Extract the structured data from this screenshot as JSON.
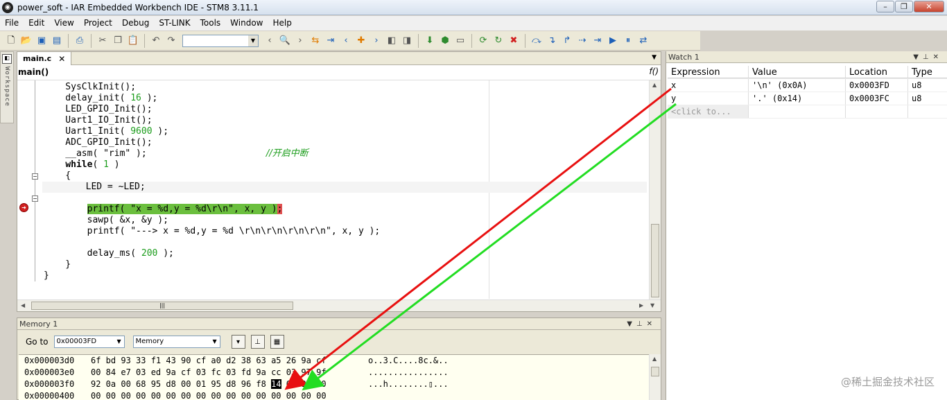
{
  "window": {
    "title": "power_soft - IAR Embedded Workbench IDE - STM8 3.11.1",
    "controls": [
      "–",
      "❐",
      "✕"
    ]
  },
  "menu": [
    "File",
    "Edit",
    "View",
    "Project",
    "Debug",
    "ST-LINK",
    "Tools",
    "Window",
    "Help"
  ],
  "workspace": {
    "label": "Workspace"
  },
  "editor": {
    "tab": "main.c",
    "tab_close": "✕",
    "function": "main()",
    "function_icon": "f()",
    "lines": [
      {
        "t": "    SysClkInit();"
      },
      {
        "t": "    delay_init( ",
        "n": "16",
        "e": " );"
      },
      {
        "t": "    LED_GPIO_Init();"
      },
      {
        "t": "    Uart1_IO_Init();"
      },
      {
        "t": "    Uart1_Init( ",
        "n": "9600",
        "e": " );"
      },
      {
        "t": "    ADC_GPIO_Init();"
      },
      {
        "t": "    __asm( \"rim\" );                      ",
        "c": "//开启中断"
      },
      {
        "k": "while",
        "t2": "( ",
        "n": "1",
        "e": " )",
        "pre": "    "
      },
      {
        "t": "    {"
      },
      {
        "t": "        LED = ~LED;"
      },
      {
        "t": ""
      },
      {
        "t": "        ",
        "h": "printf( \"x = %d,y = %d\\r\\n\", x, y )",
        "he": ";"
      },
      {
        "t": "        sawp( &x, &y );"
      },
      {
        "t": "        printf( \"---> x = %d,y = %d \\r\\n\\r\\n\\r\\n\\r\\n\", x, y );"
      },
      {
        "t": ""
      },
      {
        "t": "        delay_ms( ",
        "n": "200",
        "e": " );"
      },
      {
        "t": "    }"
      },
      {
        "t": "}"
      }
    ]
  },
  "watch": {
    "title": "Watch 1",
    "columns": [
      "Expression",
      "Value",
      "Location",
      "Type"
    ],
    "rows": [
      {
        "expr": "x",
        "value": "'\\n' (0x0A)",
        "location": "0x0003FD",
        "type": "u8"
      },
      {
        "expr": "y",
        "value": "'.' (0x14)",
        "location": "0x0003FC",
        "type": "u8"
      }
    ],
    "add_hint": "<click to..."
  },
  "memory": {
    "title": "Memory 1",
    "goto_label": "Go to",
    "goto_value": "0x00003FD",
    "zone": "Memory",
    "rows": [
      {
        "addr": "0x000003d0",
        "bytes": "6f bd 93 33 f1 43 90 cf a0 d2 38 63 a5 26 9a cf",
        "ascii": "o..3.C....8c.&.."
      },
      {
        "addr": "0x000003e0",
        "bytes": "00 84 e7 03 ed 9a cf 03 fc 03 fd 9a cc 03 97 9f",
        "ascii": "................"
      },
      {
        "addr": "0x000003f0",
        "pre": "92 0a 00 68 95 d8 00 01 95 d8 96 f8 ",
        "sel": "14",
        "post": " 0a 9b 90",
        "ascii": "...h........▯..."
      },
      {
        "addr": "0x00000400",
        "bytes": "00 00 00 00 00 00 00 00 00 00 00 00 00 00 00 00",
        "ascii": ""
      }
    ]
  },
  "watermark": "@稀土掘金技术社区",
  "colors": {
    "arrow_red": "#e81010",
    "arrow_green": "#22dd22",
    "highlight": "#6bbf3e"
  }
}
